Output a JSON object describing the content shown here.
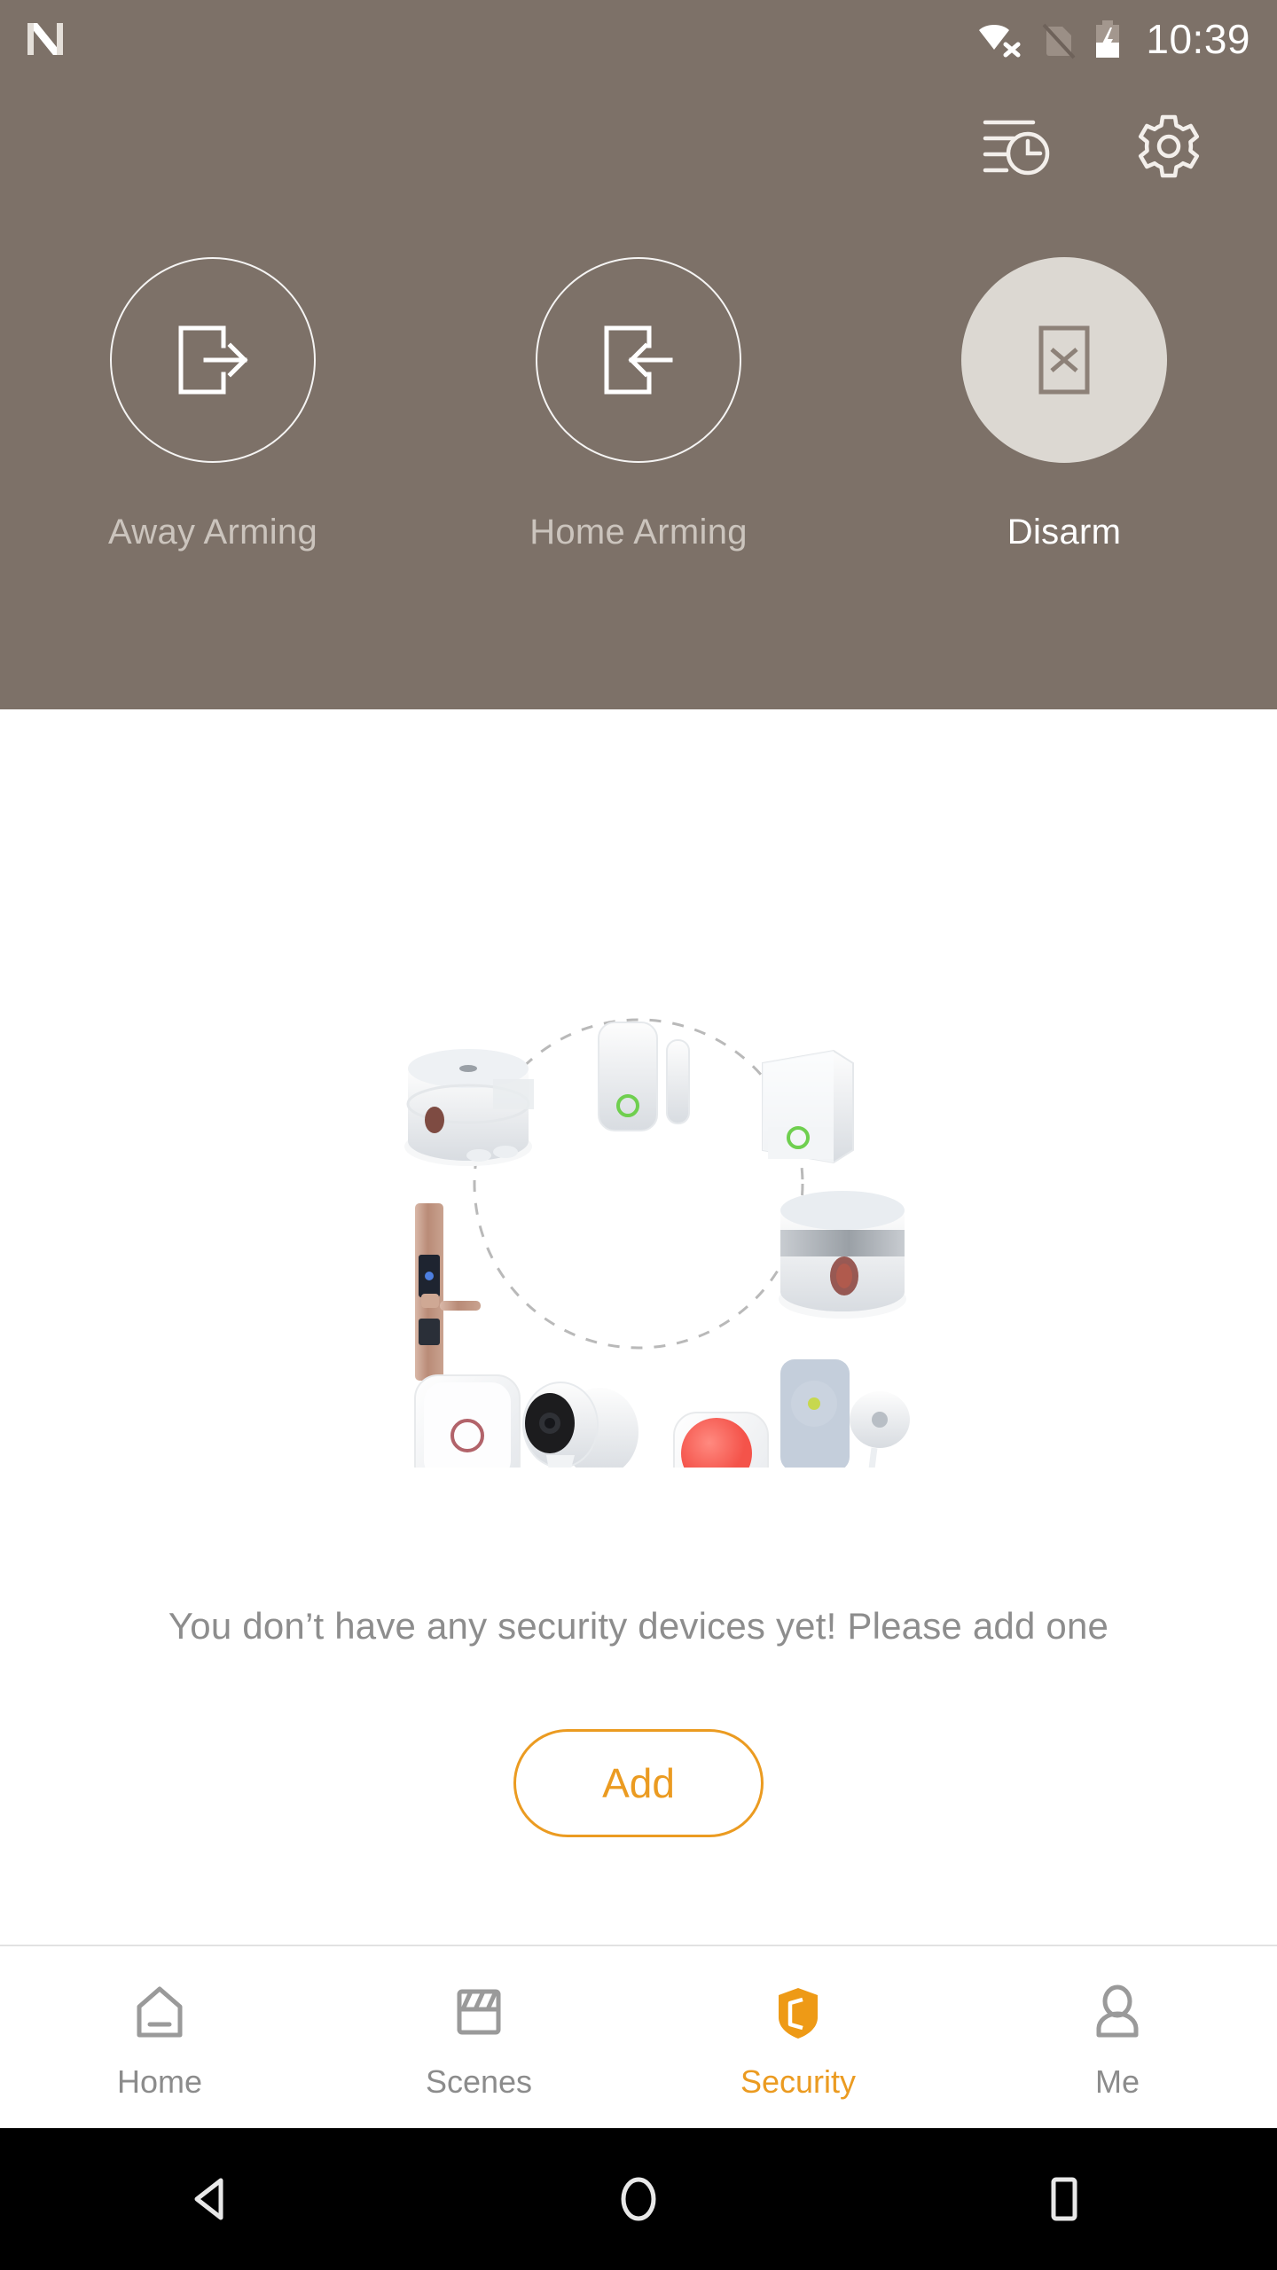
{
  "status_bar": {
    "app_badge_icon": "ninja-n-logo",
    "icons": [
      "wifi-no-connection-icon",
      "sim-card-disabled-icon",
      "battery-charging-icon"
    ],
    "time": "10:39"
  },
  "header": {
    "background_color": "#7d7168",
    "actions": [
      {
        "name": "history-log-icon",
        "label": "History"
      },
      {
        "name": "settings-gear-icon",
        "label": "Settings"
      }
    ],
    "arming_modes": [
      {
        "id": "away",
        "label": "Away Arming",
        "icon": "door-exit-arrow-right-icon",
        "active": false
      },
      {
        "id": "home",
        "label": "Home Arming",
        "icon": "door-enter-arrow-left-icon",
        "active": false
      },
      {
        "id": "disarm",
        "label": "Disarm",
        "icon": "door-cross-x-icon",
        "active": true
      }
    ],
    "active_mode": "Disarm",
    "active_circle_color": "#dcd8d2",
    "inactive_label_color": "#cbc4bd",
    "active_label_color": "#ffffff"
  },
  "main": {
    "illustration": {
      "name": "security-devices-ring-illustration",
      "devices": [
        "door-window-contact-sensor",
        "motion-pir-sensor",
        "siren-alarm",
        "water-leak-sensor",
        "sos-emergency-button",
        "indoor-camera",
        "wireless-panel-button",
        "smart-door-lock",
        "smoke-detector"
      ]
    },
    "empty_message": "You don’t have any security devices yet! Please add one",
    "empty_message_color": "#8d8d8d",
    "add_button": {
      "label": "Add",
      "border_color": "#eb9b21",
      "text_color": "#eb9b21"
    }
  },
  "bottom_nav": {
    "accent_color": "#eb9b21",
    "inactive_color": "#8c8c8c",
    "items": [
      {
        "label": "Home",
        "icon": "house-outline-icon",
        "active": false
      },
      {
        "label": "Scenes",
        "icon": "clapperboard-icon",
        "active": false
      },
      {
        "label": "Security",
        "icon": "shield-icon",
        "active": true
      },
      {
        "label": "Me",
        "icon": "person-outline-icon",
        "active": false
      }
    ]
  },
  "android_nav": {
    "buttons": [
      {
        "name": "back-triangle-icon",
        "label": "Back"
      },
      {
        "name": "home-circle-icon",
        "label": "Home"
      },
      {
        "name": "recents-square-icon",
        "label": "Recents"
      }
    ]
  }
}
